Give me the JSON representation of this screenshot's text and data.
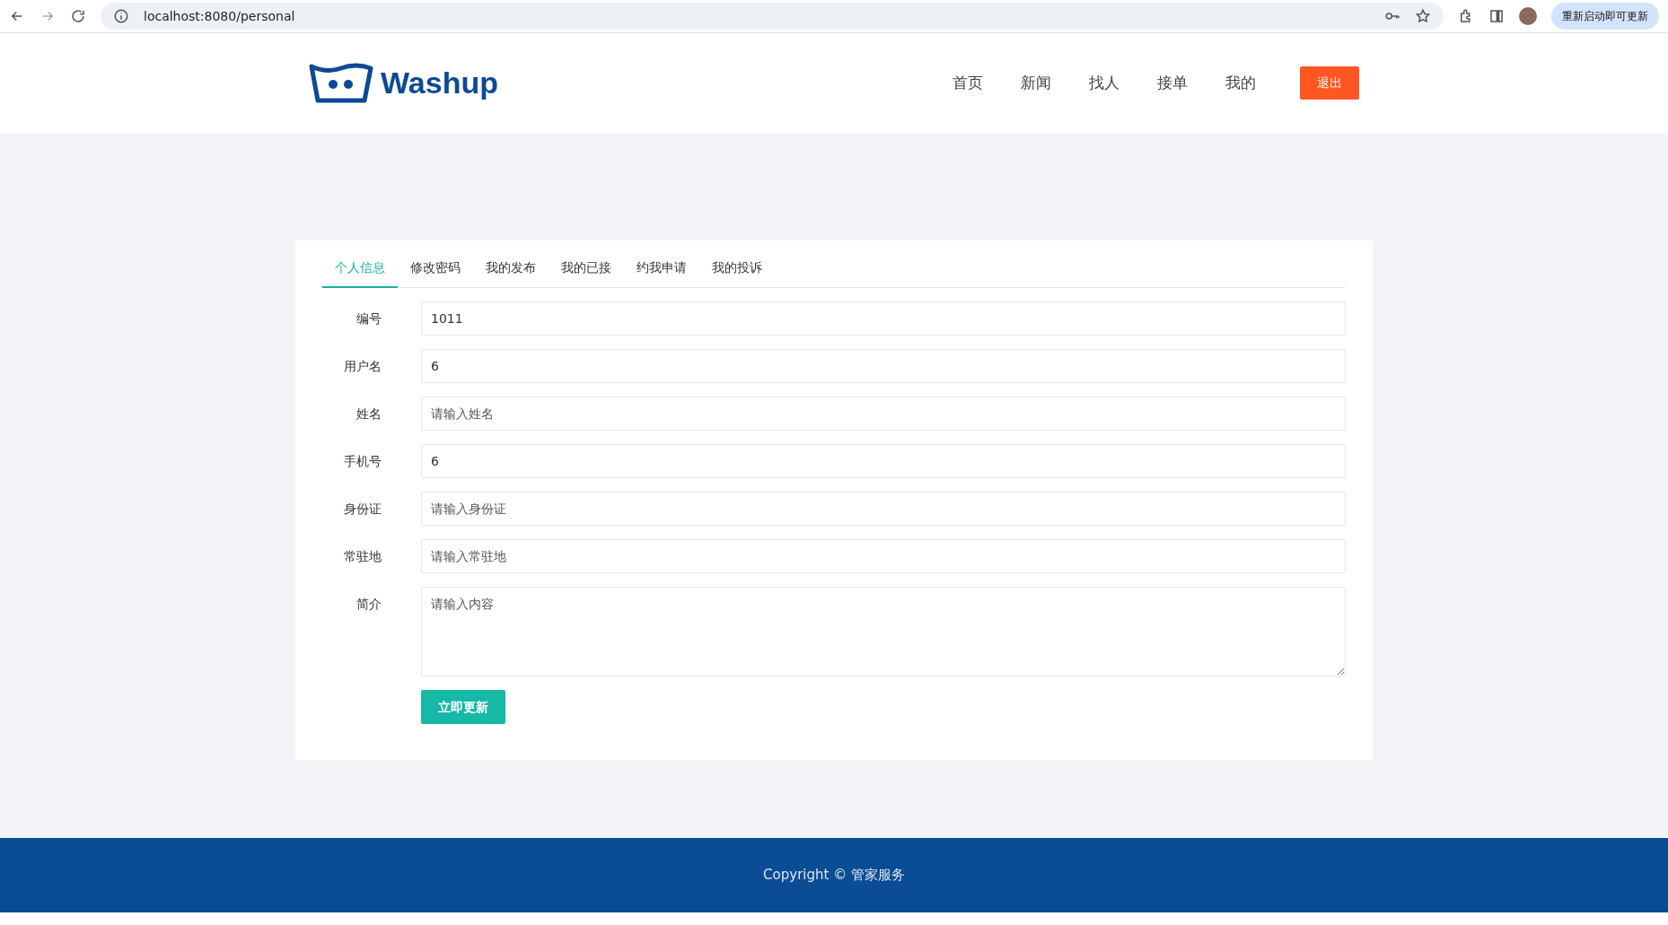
{
  "browser": {
    "url": "localhost:8080/personal",
    "update_button": "重新启动即可更新"
  },
  "header": {
    "logo": "Washup",
    "nav": [
      {
        "label": "首页"
      },
      {
        "label": "新闻"
      },
      {
        "label": "找人"
      },
      {
        "label": "接单"
      },
      {
        "label": "我的"
      }
    ],
    "logout": "退出"
  },
  "tabs": [
    {
      "label": "个人信息",
      "selected": true
    },
    {
      "label": "修改密码",
      "selected": false
    },
    {
      "label": "我的发布",
      "selected": false
    },
    {
      "label": "我的已接",
      "selected": false
    },
    {
      "label": "约我申请",
      "selected": false
    },
    {
      "label": "我的投诉",
      "selected": false
    }
  ],
  "form": {
    "fields": [
      {
        "kind": "input",
        "label": "编号",
        "value": "1011"
      },
      {
        "kind": "input",
        "label": "用户名",
        "value": "6"
      },
      {
        "kind": "input",
        "label": "姓名",
        "placeholder": "请输入姓名"
      },
      {
        "kind": "input",
        "label": "手机号",
        "value": "6"
      },
      {
        "kind": "input",
        "label": "身份证",
        "placeholder": "请输入身份证"
      },
      {
        "kind": "input",
        "label": "常驻地",
        "placeholder": "请输入常驻地"
      },
      {
        "kind": "textarea",
        "label": "简介",
        "placeholder": "请输入内容"
      }
    ],
    "submit": "立即更新"
  },
  "footer": {
    "copyright": "Copyright © 管家服务"
  }
}
